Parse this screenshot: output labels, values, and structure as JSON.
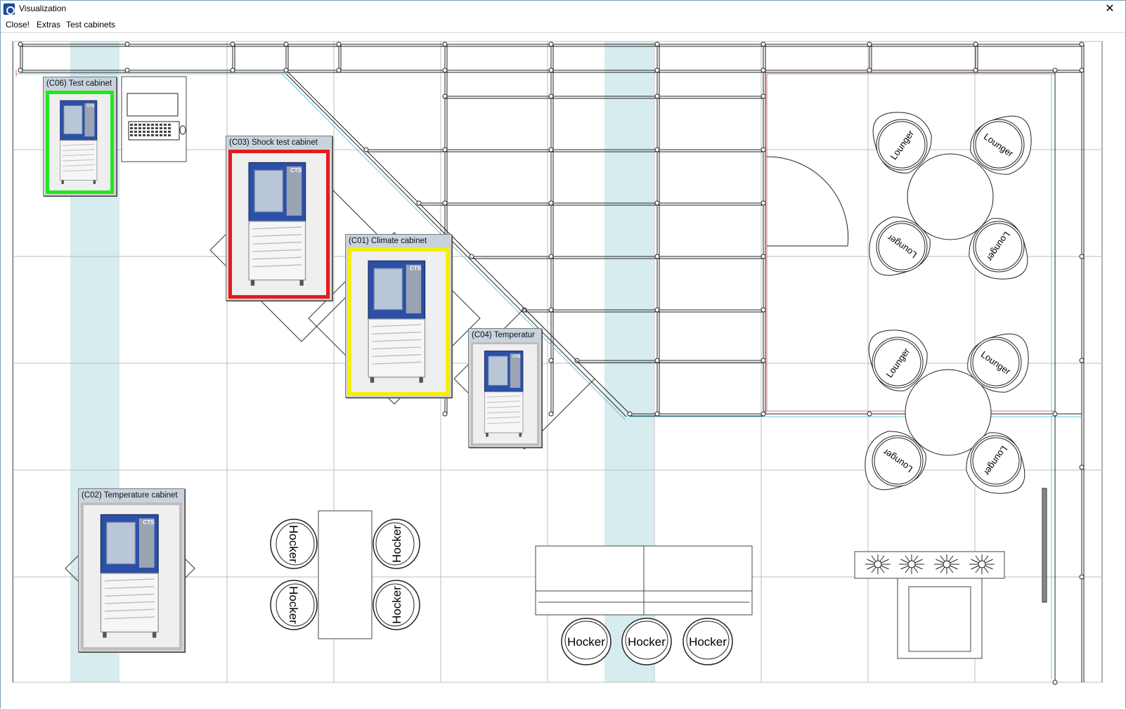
{
  "window": {
    "title": "Visualization",
    "close_glyph": "✕"
  },
  "menu": {
    "items": [
      "Close!",
      "Extras",
      "Test cabinets"
    ]
  },
  "cabinets": [
    {
      "id": "c06",
      "title": "(C06) Test cabinet",
      "status_color": "#22e622"
    },
    {
      "id": "c03",
      "title": "(C03) Shock test cabinet",
      "status_color": "#e41b1b"
    },
    {
      "id": "c01",
      "title": "(C01) Climate cabinet",
      "status_color": "#f5f000"
    },
    {
      "id": "c04",
      "title": "(C04) Temperatur",
      "status_color": "#bdbdbd"
    },
    {
      "id": "c02",
      "title": "(C02) Temperature cabinet",
      "status_color": "#bdbdbd"
    }
  ],
  "cabinet_logo": "CTS",
  "furniture": {
    "lounger_label": "Lounger",
    "hocker_label": "Hocker"
  },
  "colors": {
    "column_fill": "#d6ecef",
    "grid_line": "#9a9a9a",
    "wall_red": "#d07070",
    "wall_cyan": "#6cc8d4"
  }
}
